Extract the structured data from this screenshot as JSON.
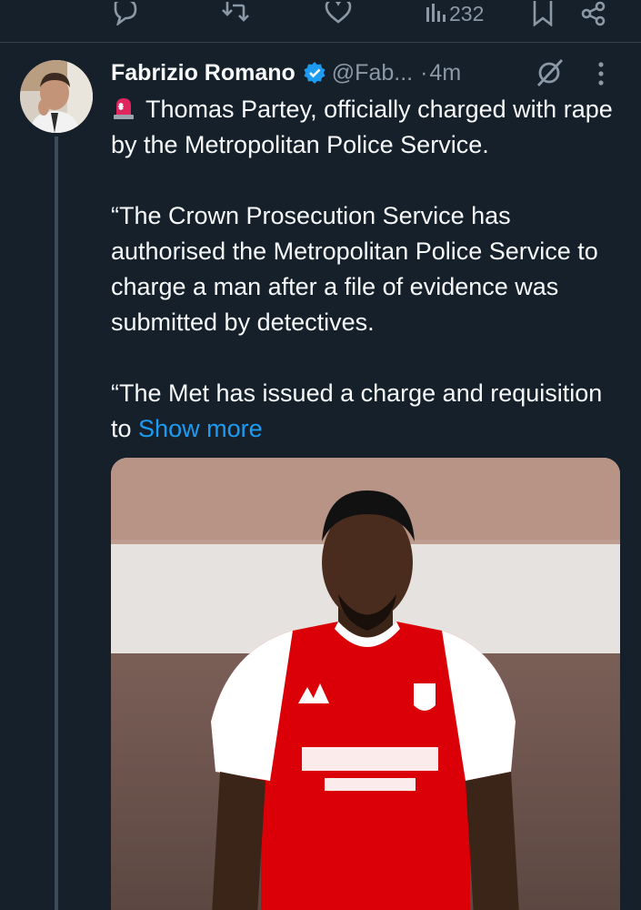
{
  "previous_tweet_actions": {
    "views_count": "232",
    "icons": [
      "reply-icon",
      "retweet-icon",
      "like-icon",
      "views-icon",
      "bookmark-icon",
      "share-icon"
    ]
  },
  "tweet": {
    "author_name": "Fabrizio Romano",
    "handle": "@Fab...",
    "separator": "·",
    "time": "4m",
    "paragraph_1": "Thomas Partey, officially charged with rape by the Metropolitan Police Service.",
    "paragraph_2": "“The Crown Prosecution Service has authorised the Metropolitan Police Service to charge a man after a file of evidence was submitted by detectives.",
    "paragraph_3": "“The Met has issued a charge and requisition to",
    "show_more": "Show more"
  },
  "colors": {
    "background": "#15202b",
    "text": "#f7f9f9",
    "muted": "#8b98a5",
    "link": "#1d9bf0",
    "verified": "#1d9bf0",
    "jersey_red": "#db0007"
  }
}
